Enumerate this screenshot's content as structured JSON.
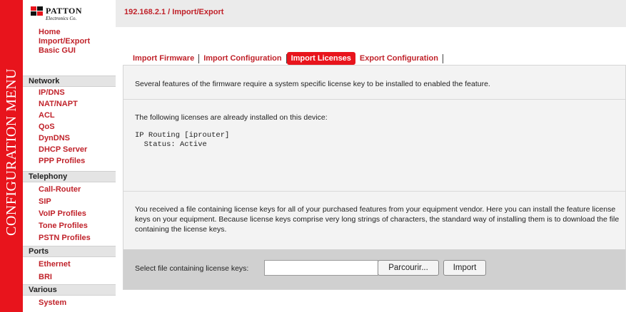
{
  "side_banner": {
    "text": "CONFIGURATION MENU"
  },
  "logo": {
    "brand": "PATTON",
    "sub": "Electronics Co."
  },
  "sidebar": {
    "top_links": [
      {
        "label": "Home"
      },
      {
        "label": "Import/Export"
      },
      {
        "label": "Basic GUI"
      }
    ],
    "groups": [
      {
        "title": "Network",
        "items": [
          "IP/DNS",
          "NAT/NAPT",
          "ACL",
          "QoS",
          "DynDNS",
          "DHCP Server",
          "PPP Profiles"
        ]
      },
      {
        "title": "Telephony",
        "items": [
          "Call-Router",
          "SIP",
          "VoIP Profiles",
          "Tone Profiles",
          "PSTN Profiles"
        ]
      },
      {
        "title": "Ports",
        "items": [
          "Ethernet",
          "BRI"
        ]
      },
      {
        "title": "Various",
        "items": [
          "System"
        ]
      }
    ]
  },
  "header": {
    "breadcrumb": "192.168.2.1 / Import/Export"
  },
  "tabs": [
    {
      "label": "Import Firmware",
      "active": false
    },
    {
      "label": "Import Configuration",
      "active": false
    },
    {
      "label": "Import Licenses",
      "active": true
    },
    {
      "label": "Export Configuration",
      "active": false
    }
  ],
  "content": {
    "intro": "Several features of the firmware require a system specific license key to be installed to enabled the feature.",
    "installed_heading": "The following licenses are already installed on this device:",
    "license_line1": "IP Routing [iprouter]",
    "license_line2": "  Status: Active",
    "instructions": "You received a file containing license keys for all of your purchased features from your equipment vendor. Here you can install the feature license keys on your equipment. Because license keys comprise very long strings of characters, the standard way of installing them is to download the file containing the license keys."
  },
  "form": {
    "label": "Select file containing license keys:",
    "file_value": "",
    "browse_button": "Parcourir...",
    "import_button": "Import"
  },
  "colors": {
    "accent_red": "#e8141c",
    "link_red": "#c0222a",
    "header_gray": "#ebebeb",
    "form_gray": "#d0d0d0"
  }
}
